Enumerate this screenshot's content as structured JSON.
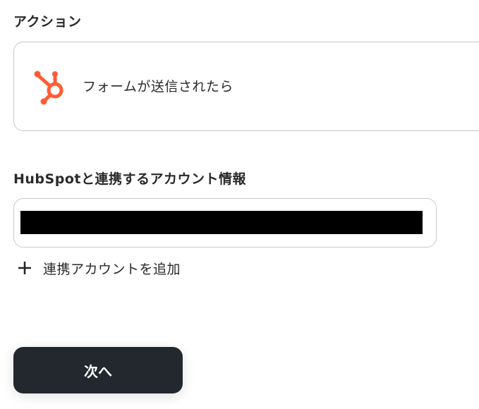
{
  "sections": {
    "action_title": "アクション",
    "account_title": "HubSpotと連携するアカウント情報"
  },
  "action": {
    "icon": "hubspot-icon",
    "label": "フォームが送信されたら"
  },
  "account": {
    "selected_value": "",
    "redacted": true
  },
  "add_account": {
    "icon": "plus-icon",
    "label": "連携アカウントを追加"
  },
  "buttons": {
    "next_label": "次へ"
  },
  "colors": {
    "hubspot_orange": "#ff5c35",
    "button_bg": "#23272e",
    "border": "#c8c8c8"
  }
}
